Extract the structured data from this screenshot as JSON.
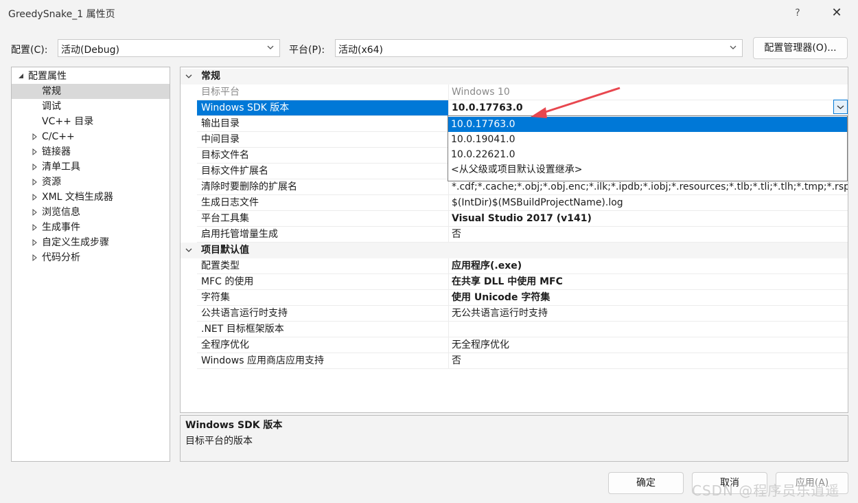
{
  "window": {
    "title": "GreedySnake_1 属性页",
    "help_label": "?",
    "close_label": "✕"
  },
  "toolbar": {
    "config_label": "配置(C):",
    "config_value": "活动(Debug)",
    "platform_label": "平台(P):",
    "platform_value": "活动(x64)",
    "config_manager_label": "配置管理器(O)..."
  },
  "tree": {
    "items": [
      {
        "label": "配置属性",
        "expander": "expanded",
        "level": 0,
        "selected": false
      },
      {
        "label": "常规",
        "expander": "none",
        "level": 1,
        "selected": true
      },
      {
        "label": "调试",
        "expander": "none",
        "level": 1,
        "selected": false
      },
      {
        "label": "VC++ 目录",
        "expander": "none",
        "level": 1,
        "selected": false
      },
      {
        "label": "C/C++",
        "expander": "collapsed",
        "level": 1,
        "selected": false
      },
      {
        "label": "链接器",
        "expander": "collapsed",
        "level": 1,
        "selected": false
      },
      {
        "label": "清单工具",
        "expander": "collapsed",
        "level": 1,
        "selected": false
      },
      {
        "label": "资源",
        "expander": "collapsed",
        "level": 1,
        "selected": false
      },
      {
        "label": "XML 文档生成器",
        "expander": "collapsed",
        "level": 1,
        "selected": false
      },
      {
        "label": "浏览信息",
        "expander": "collapsed",
        "level": 1,
        "selected": false
      },
      {
        "label": "生成事件",
        "expander": "collapsed",
        "level": 1,
        "selected": false
      },
      {
        "label": "自定义生成步骤",
        "expander": "collapsed",
        "level": 1,
        "selected": false
      },
      {
        "label": "代码分析",
        "expander": "collapsed",
        "level": 1,
        "selected": false
      }
    ]
  },
  "grid": {
    "rows": [
      {
        "type": "category",
        "name": "常规"
      },
      {
        "type": "prop",
        "name": "目标平台",
        "value": "Windows 10",
        "disabled": true
      },
      {
        "type": "prop",
        "name": "Windows SDK 版本",
        "value": "10.0.17763.0",
        "bold": true,
        "selected": true
      },
      {
        "type": "prop",
        "name": "输出目录",
        "value": ""
      },
      {
        "type": "prop",
        "name": "中间目录",
        "value": ""
      },
      {
        "type": "prop",
        "name": "目标文件名",
        "value": ""
      },
      {
        "type": "prop",
        "name": "目标文件扩展名",
        "value": ""
      },
      {
        "type": "prop",
        "name": "清除时要删除的扩展名",
        "value": "*.cdf;*.cache;*.obj;*.obj.enc;*.ilk;*.ipdb;*.iobj;*.resources;*.tlb;*.tli;*.tlh;*.tmp;*.rsp;*.pgc;*.pgd"
      },
      {
        "type": "prop",
        "name": "生成日志文件",
        "value": "$(IntDir)$(MSBuildProjectName).log"
      },
      {
        "type": "prop",
        "name": "平台工具集",
        "value": "Visual Studio 2017 (v141)",
        "bold": true
      },
      {
        "type": "prop",
        "name": "启用托管增量生成",
        "value": "否"
      },
      {
        "type": "category",
        "name": "项目默认值"
      },
      {
        "type": "prop",
        "name": "配置类型",
        "value": "应用程序(.exe)",
        "bold": true
      },
      {
        "type": "prop",
        "name": "MFC 的使用",
        "value": "在共享 DLL 中使用 MFC",
        "bold": true
      },
      {
        "type": "prop",
        "name": "字符集",
        "value": "使用 Unicode 字符集",
        "bold": true
      },
      {
        "type": "prop",
        "name": "公共语言运行时支持",
        "value": "无公共语言运行时支持"
      },
      {
        "type": "prop",
        "name": ".NET 目标框架版本",
        "value": ""
      },
      {
        "type": "prop",
        "name": "全程序优化",
        "value": "无全程序优化"
      },
      {
        "type": "prop",
        "name": "Windows 应用商店应用支持",
        "value": "否"
      }
    ]
  },
  "sdk_dropdown": {
    "options": [
      "10.0.17763.0",
      "10.0.19041.0",
      "10.0.22621.0",
      "<从父级或项目默认设置继承>"
    ],
    "selected_index": 0
  },
  "description": {
    "title": "Windows SDK 版本",
    "text": "目标平台的版本"
  },
  "footer": {
    "ok_label": "确定",
    "cancel_label": "取消",
    "apply_label": "应用(A)"
  },
  "watermark": "CSDN @程序员乐逍遥",
  "colors": {
    "selection": "#0078d7",
    "annotation_arrow": "#e8474f"
  }
}
